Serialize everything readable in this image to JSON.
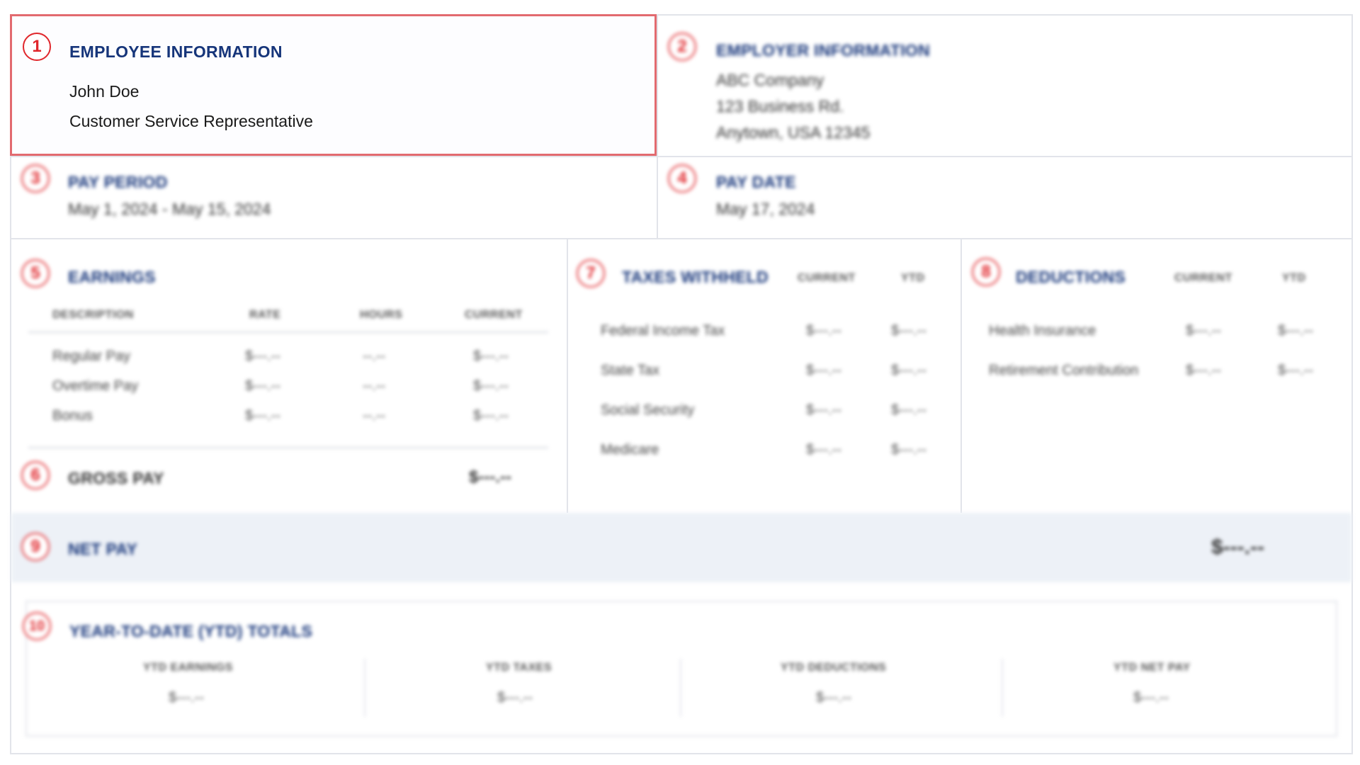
{
  "employee": {
    "number": "1",
    "title": "EMPLOYEE INFORMATION",
    "name": "John Doe",
    "role": "Customer Service Representative"
  },
  "employer": {
    "number": "2",
    "title": "EMPLOYER INFORMATION",
    "company": "ABC Company",
    "address1": "123 Business Rd.",
    "address2": "Anytown, USA 12345"
  },
  "pay_period": {
    "number": "3",
    "title": "PAY PERIOD",
    "value": "May 1, 2024 - May 15, 2024"
  },
  "pay_date": {
    "number": "4",
    "title": "PAY DATE",
    "value": "May 17, 2024"
  },
  "earnings": {
    "number": "5",
    "title": "EARNINGS",
    "columns": [
      "DESCRIPTION",
      "RATE",
      "HOURS",
      "CURRENT"
    ],
    "rows": [
      {
        "description": "Regular Pay",
        "rate": "$---.--",
        "hours": "--.--",
        "current": "$---.--"
      },
      {
        "description": "Overtime Pay",
        "rate": "$---.--",
        "hours": "--.--",
        "current": "$---.--"
      },
      {
        "description": "Bonus",
        "rate": "$---.--",
        "hours": "--.--",
        "current": "$---.--"
      }
    ]
  },
  "gross_pay": {
    "number": "6",
    "title": "GROSS PAY",
    "value": "$---.--"
  },
  "taxes": {
    "number": "7",
    "title": "TAXES WITHHELD",
    "columns": [
      "CURRENT",
      "YTD"
    ],
    "rows": [
      {
        "label": "Federal Income Tax",
        "current": "$---.--",
        "ytd": "$---.--"
      },
      {
        "label": "State Tax",
        "current": "$---.--",
        "ytd": "$---.--"
      },
      {
        "label": "Social Security",
        "current": "$---.--",
        "ytd": "$---.--"
      },
      {
        "label": "Medicare",
        "current": "$---.--",
        "ytd": "$---.--"
      }
    ]
  },
  "deductions": {
    "number": "8",
    "title": "DEDUCTIONS",
    "columns": [
      "CURRENT",
      "YTD"
    ],
    "rows": [
      {
        "label": "Health Insurance",
        "current": "$---.--",
        "ytd": "$---.--"
      },
      {
        "label": "Retirement Contribution",
        "current": "$---.--",
        "ytd": "$---.--"
      }
    ]
  },
  "net_pay": {
    "number": "9",
    "title": "NET PAY",
    "value": "$---.--"
  },
  "ytd_totals": {
    "number": "10",
    "title": "YEAR-TO-DATE (YTD) TOTALS",
    "items": [
      {
        "label": "YTD EARNINGS",
        "value": "$---.--"
      },
      {
        "label": "YTD TAXES",
        "value": "$---.--"
      },
      {
        "label": "YTD DEDUCTIONS",
        "value": "$---.--"
      },
      {
        "label": "YTD NET PAY",
        "value": "$---.--"
      }
    ]
  },
  "colors": {
    "accent_red": "#e0262b",
    "title_blue": "#16357a",
    "net_pay_band": "#edf1f7"
  }
}
